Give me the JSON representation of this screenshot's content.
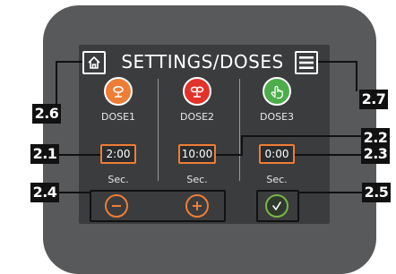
{
  "screen": {
    "title": "SETTINGS/DOSES",
    "home_icon": "home-icon",
    "menu_icon": "menu-icon"
  },
  "doses": [
    {
      "label": "DOSE1",
      "time": "2:00",
      "unit": "Sec.",
      "icon": "seed-sprout-icon",
      "color": "#ee7d36"
    },
    {
      "label": "DOSE2",
      "time": "10:00",
      "unit": "Sec.",
      "icon": "seed-sprout-icon",
      "color": "#e2332b"
    },
    {
      "label": "DOSE3",
      "time": "0:00",
      "unit": "Sec.",
      "icon": "hand-pointer-icon",
      "color": "#4cad4a"
    }
  ],
  "controls": {
    "minus_icon": "minus-icon",
    "plus_icon": "plus-icon",
    "confirm_icon": "check-icon",
    "accent": "#ee7d36",
    "confirm_color": "#7ab648"
  },
  "callouts": {
    "c26": "2.6",
    "c27": "2.7",
    "c21": "2.1",
    "c22": "2.2",
    "c23": "2.3",
    "c24": "2.4",
    "c25": "2.5"
  }
}
